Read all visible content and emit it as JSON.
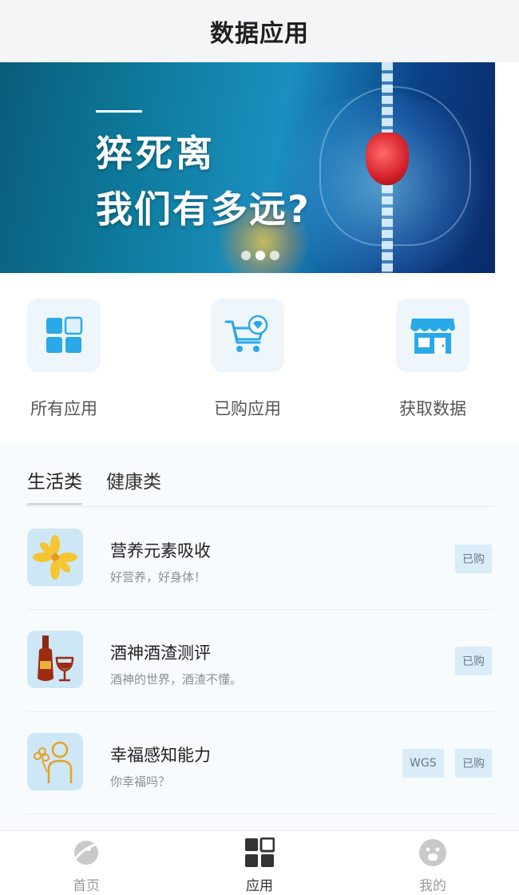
{
  "header": {
    "title": "数据应用"
  },
  "banner": {
    "line1": "猝死离",
    "line2": "我们有多远?"
  },
  "quick": [
    {
      "label": "所有应用",
      "icon": "grid-apps-icon"
    },
    {
      "label": "已购应用",
      "icon": "cart-diamond-icon"
    },
    {
      "label": "获取数据",
      "icon": "store-icon"
    }
  ],
  "tabs": [
    {
      "label": "生活类",
      "active": true
    },
    {
      "label": "健康类",
      "active": false
    }
  ],
  "apps": [
    {
      "title": "营养元素吸收",
      "subtitle": "好营养，好身体！",
      "badges": [
        "已购"
      ],
      "icon": "flower-icon"
    },
    {
      "title": "酒神酒渣测评",
      "subtitle": "酒神的世界，酒渣不懂。",
      "badges": [
        "已购"
      ],
      "icon": "wine-icon"
    },
    {
      "title": "幸福感知能力",
      "subtitle": "你幸福吗？",
      "badges": [
        "WGS",
        "已购"
      ],
      "icon": "person-flower-icon"
    }
  ],
  "tabbar": [
    {
      "label": "首页",
      "icon": "planet-icon",
      "active": false
    },
    {
      "label": "应用",
      "icon": "apps-grid-icon",
      "active": true
    },
    {
      "label": "我的",
      "icon": "face-icon",
      "active": false
    }
  ],
  "colors": {
    "accent": "#2aa9e8",
    "badge_bg": "#d9ecf8",
    "tabbar_active": "#333333"
  }
}
